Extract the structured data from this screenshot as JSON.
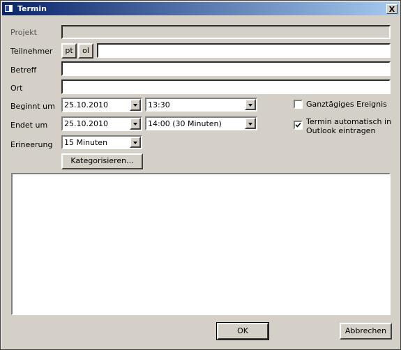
{
  "window": {
    "title": "Termin",
    "close_label": "X"
  },
  "form": {
    "projekt_label": "Projekt",
    "projekt_value": "",
    "teilnehmer_label": "Teilnehmer",
    "pt_label": "pt",
    "ol_label": "ol",
    "teilnehmer_value": "",
    "betreff_label": "Betreff",
    "betreff_value": "",
    "ort_label": "Ort",
    "ort_value": "",
    "beginnt_label": "Beginnt um",
    "beginnt_date": "25.10.2010",
    "beginnt_time": "13:30",
    "endet_label": "Endet um",
    "endet_date": "25.10.2010",
    "endet_time": "14:00 (30 Minuten)",
    "erinnerung_label": "Erineerung",
    "erinnerung_value": "15 Minuten",
    "kategorisieren_label": "Kategorisieren...",
    "ganztaegig_label": "Ganztägiges Ereignis",
    "ganztaegig_checked": false,
    "outlook_label_1": "Termin automatisch in",
    "outlook_label_2": "Outlook eintragen",
    "outlook_checked": true,
    "notes_value": ""
  },
  "footer": {
    "ok_label": "OK",
    "cancel_label": "Abbrechen"
  }
}
